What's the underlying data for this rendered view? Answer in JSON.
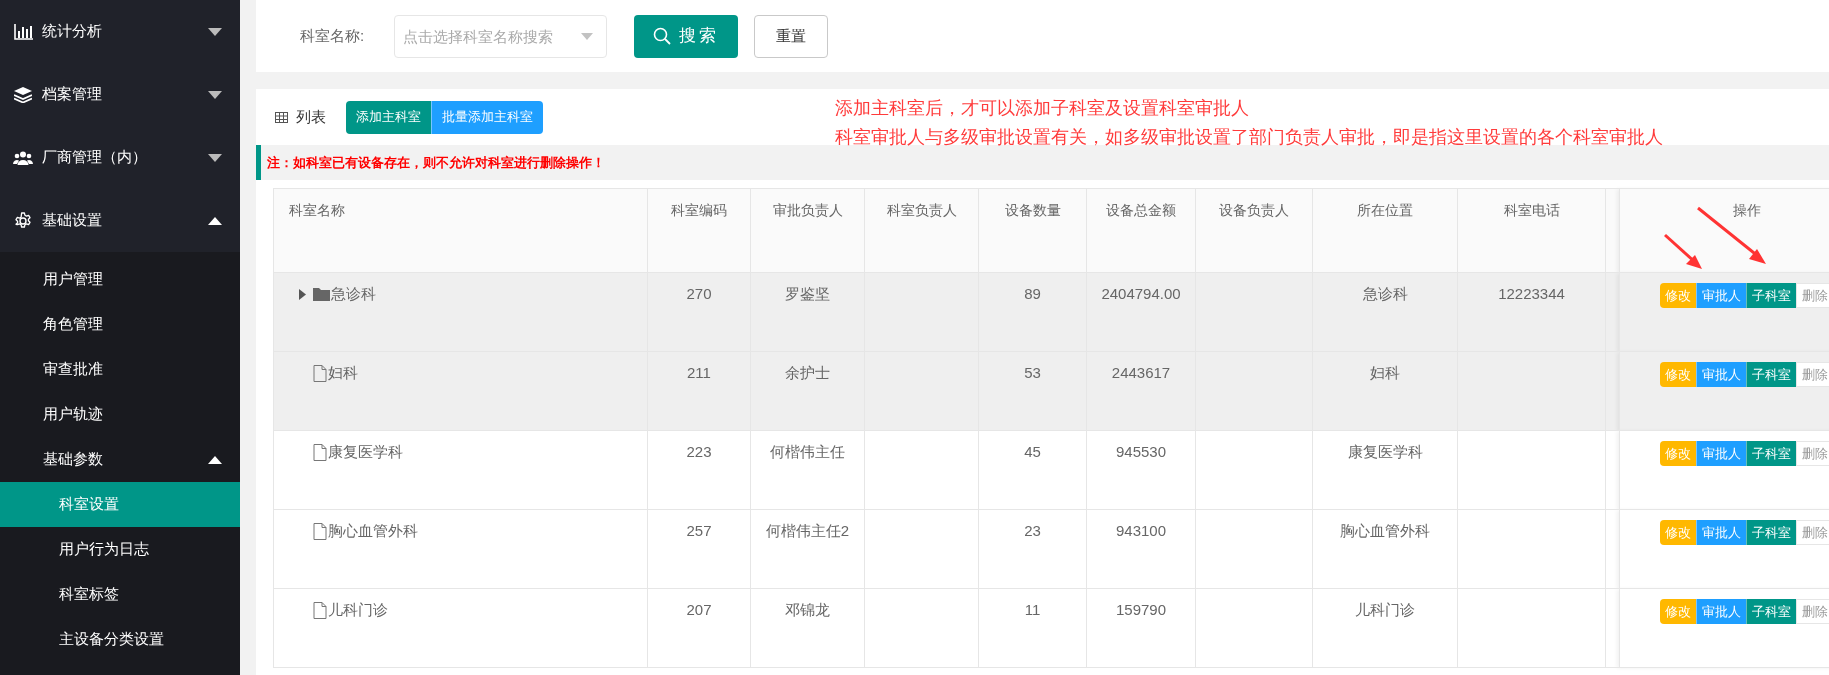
{
  "sidebar": {
    "sections": [
      {
        "label": "统计分析",
        "expanded": false
      },
      {
        "label": "档案管理",
        "expanded": false
      },
      {
        "label": "厂商管理（内）",
        "expanded": false
      },
      {
        "label": "基础设置",
        "expanded": true,
        "items": [
          {
            "label": "用户管理",
            "selected": false
          },
          {
            "label": "角色管理",
            "selected": false
          },
          {
            "label": "审查批准",
            "selected": false
          },
          {
            "label": "用户轨迹",
            "selected": false
          },
          {
            "label": "基础参数",
            "selected": false,
            "expanded": true,
            "children": [
              {
                "label": "科室设置",
                "selected": true
              },
              {
                "label": "用户行为日志",
                "selected": false
              },
              {
                "label": "科室标签",
                "selected": false
              },
              {
                "label": "主设备分类设置",
                "selected": false
              }
            ]
          }
        ]
      }
    ]
  },
  "search": {
    "label": "科室名称:",
    "placeholder": "点击选择科室名称搜索",
    "search_button": "搜索",
    "reset_button": "重置"
  },
  "list": {
    "title": "列表",
    "buttons": [
      {
        "label": "添加主科室",
        "color": "#009688"
      },
      {
        "label": "批量添加主科室",
        "color": "#1e9fff"
      }
    ],
    "annotation": [
      "添加主科室后，才可以添加子科室及设置科室审批人",
      "科室审批人与多级审批设置有关，如多级审批设置了部门负责人审批，即是指这里设置的各个科室审批人"
    ],
    "note": "注：如科室已有设备存在，则不允许对科室进行删除操作！"
  },
  "table": {
    "columns": [
      "科室名称",
      "科室编码",
      "审批负责人",
      "科室负责人",
      "设备数量",
      "设备总金额",
      "设备负责人",
      "所在位置",
      "科室电话",
      "操作"
    ],
    "rows": [
      {
        "kind": "folder",
        "expanded": false,
        "highlighted": true,
        "cells": [
          "急诊科",
          "270",
          "罗鉴坚",
          "",
          "89",
          "2404794.00",
          "",
          "急诊科",
          "12223344"
        ],
        "actions": [
          {
            "label": "修改",
            "disabled": false
          },
          {
            "label": "审批人",
            "disabled": false
          },
          {
            "label": "子科室",
            "disabled": false
          },
          {
            "label": "删除",
            "disabled": true
          }
        ]
      },
      {
        "kind": "file",
        "highlighted": true,
        "cells": [
          "妇科",
          "211",
          "余护士",
          "",
          "53",
          "2443617",
          "",
          "妇科",
          ""
        ],
        "actions": [
          {
            "label": "修改",
            "disabled": false
          },
          {
            "label": "审批人",
            "disabled": false
          },
          {
            "label": "子科室",
            "disabled": false
          },
          {
            "label": "删除",
            "disabled": true
          }
        ]
      },
      {
        "kind": "file",
        "highlighted": false,
        "cells": [
          "康复医学科",
          "223",
          "何楷伟主任",
          "",
          "45",
          "945530",
          "",
          "康复医学科",
          ""
        ],
        "actions": [
          {
            "label": "修改",
            "disabled": false
          },
          {
            "label": "审批人",
            "disabled": false
          },
          {
            "label": "子科室",
            "disabled": false
          },
          {
            "label": "删除",
            "disabled": true
          }
        ]
      },
      {
        "kind": "file",
        "highlighted": false,
        "cells": [
          "胸心血管外科",
          "257",
          "何楷伟主任2",
          "",
          "23",
          "943100",
          "",
          "胸心血管外科",
          ""
        ],
        "actions": [
          {
            "label": "修改",
            "disabled": false
          },
          {
            "label": "审批人",
            "disabled": false
          },
          {
            "label": "子科室",
            "disabled": false
          },
          {
            "label": "删除",
            "disabled": true
          }
        ]
      },
      {
        "kind": "file",
        "highlighted": false,
        "cells": [
          "儿科门诊",
          "207",
          "邓锦龙",
          "",
          "11",
          "159790",
          "",
          "儿科门诊",
          ""
        ],
        "actions": [
          {
            "label": "修改",
            "disabled": false
          },
          {
            "label": "审批人",
            "disabled": false
          },
          {
            "label": "子科室",
            "disabled": false
          },
          {
            "label": "删除",
            "disabled": true
          }
        ]
      }
    ]
  }
}
